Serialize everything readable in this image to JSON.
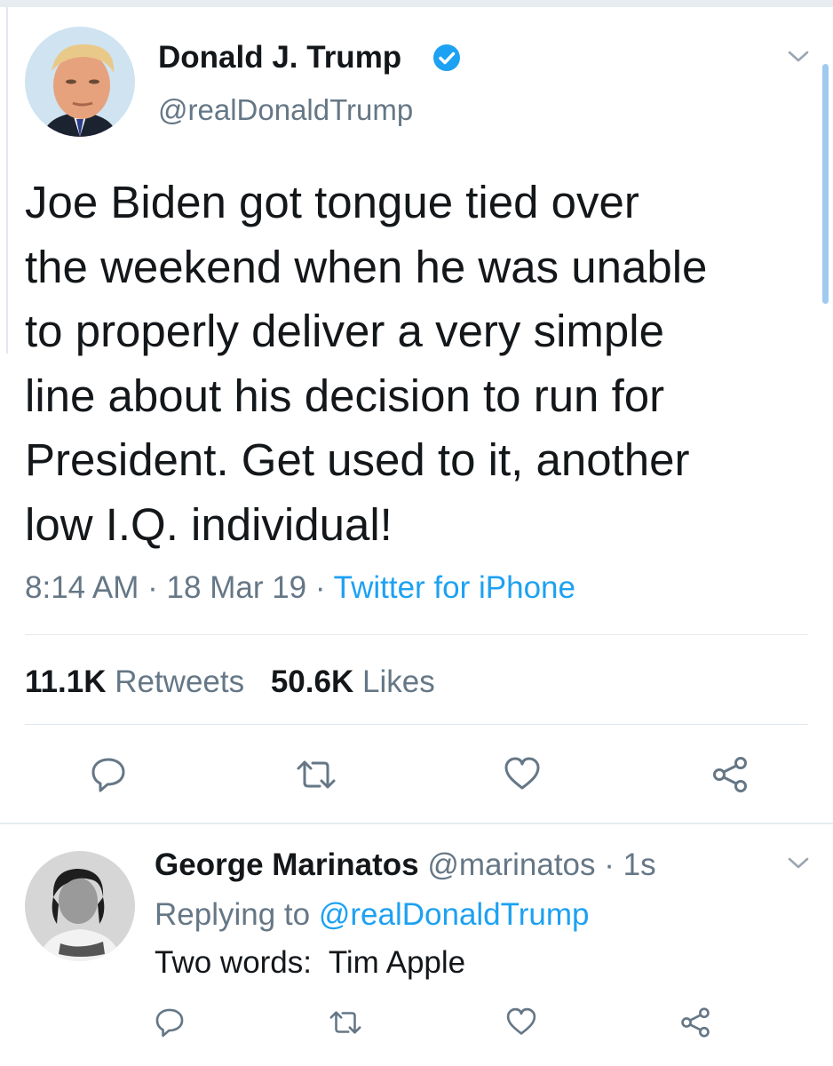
{
  "colors": {
    "accent": "#1da1f2",
    "text": "#14171a",
    "muted": "#657786",
    "divider": "#e1e8ed",
    "like_icon": "#8899a6"
  },
  "tweet": {
    "author": {
      "name": "Donald J. Trump",
      "handle": "@realDonaldTrump",
      "verified_icon": "verified-badge-icon"
    },
    "text_lines": [
      "Joe Biden got tongue tied over",
      "the weekend when he was unable",
      "to properly deliver a very simple",
      "line about his decision to run for",
      "President. Get used to it, another",
      "low I.Q. individual!"
    ],
    "time": "8:14 AM",
    "date": "18 Mar 19",
    "separator": "·",
    "source": "Twitter for iPhone",
    "stats": {
      "retweets_count": "11.1K",
      "retweets_label": "Retweets",
      "likes_count": "50.6K",
      "likes_label": "Likes"
    },
    "actions": [
      "reply-icon",
      "retweet-icon",
      "like-icon",
      "share-icon"
    ]
  },
  "reply": {
    "author": {
      "name": "George Marinatos",
      "handle": "@marinatos",
      "separator": "·",
      "time": "1s"
    },
    "replying_label": "Replying to",
    "replying_to": "@realDonaldTrump",
    "text": "Two words:  Tim Apple",
    "actions": [
      "reply-icon",
      "retweet-icon",
      "like-icon",
      "share-icon"
    ]
  }
}
